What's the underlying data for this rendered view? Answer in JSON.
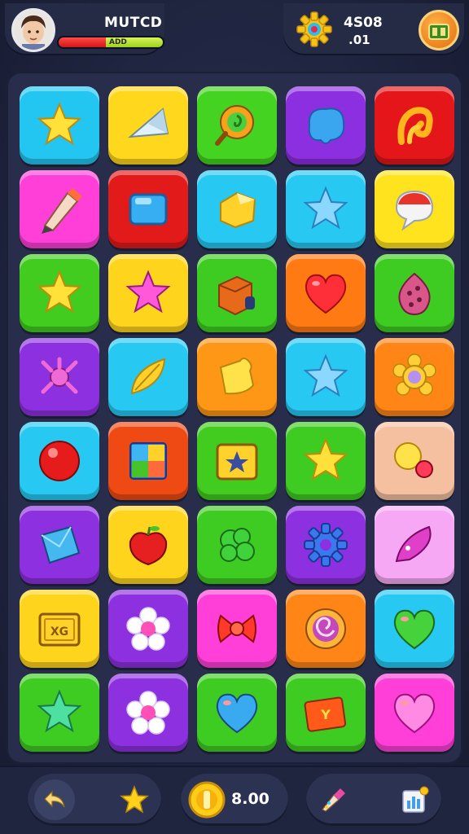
{
  "hud": {
    "player_name": "MUTCD",
    "health_label": "ADD",
    "health_level": 0.45,
    "score_top": "4S08",
    "score_bottom": ".01",
    "icons": {
      "avatar": "player-avatar",
      "gear": "gear-badge-icon",
      "chest": "treasure-chest-icon"
    },
    "colors": {
      "health_red": "#e02020",
      "health_green": "#b5e12a",
      "chest_orange": "#ef7f15"
    }
  },
  "board": {
    "rows": 8,
    "cols": 5,
    "tiles": [
      {
        "color": "#23c6f0",
        "icon": "star-icon"
      },
      {
        "color": "#ffd71c",
        "icon": "crystal-icon"
      },
      {
        "color": "#45d321",
        "icon": "swirl-ring-icon"
      },
      {
        "color": "#8b2fe0",
        "icon": "blob-icon"
      },
      {
        "color": "#e4161a",
        "icon": "tentacle-icon"
      },
      {
        "color": "#ff3fd8",
        "icon": "pencil-icon"
      },
      {
        "color": "#e21a1a",
        "icon": "square-gem-icon"
      },
      {
        "color": "#27c8f2",
        "icon": "star-cube-icon"
      },
      {
        "color": "#27c8f2",
        "icon": "star-icon"
      },
      {
        "color": "#ffe31e",
        "icon": "chat-bubble-icon"
      },
      {
        "color": "#41cc1f",
        "icon": "star-icon"
      },
      {
        "color": "#ffd41d",
        "icon": "star-icon"
      },
      {
        "color": "#3fcc22",
        "icon": "box-icon"
      },
      {
        "color": "#ff7a12",
        "icon": "heart-icon"
      },
      {
        "color": "#3fcc22",
        "icon": "egg-icon"
      },
      {
        "color": "#8d30df",
        "icon": "spider-icon"
      },
      {
        "color": "#27c8f2",
        "icon": "leaf-icon"
      },
      {
        "color": "#ff9716",
        "icon": "puzzle-icon"
      },
      {
        "color": "#27c8f2",
        "icon": "star-icon"
      },
      {
        "color": "#ff8516",
        "icon": "flower-ring-icon"
      },
      {
        "color": "#27c8f2",
        "icon": "ball-icon"
      },
      {
        "color": "#ef4a14",
        "icon": "window-icon"
      },
      {
        "color": "#41cc1f",
        "icon": "star-box-icon"
      },
      {
        "color": "#3fcc22",
        "icon": "star-icon"
      },
      {
        "color": "#f4c0a0",
        "icon": "bubbles-icon"
      },
      {
        "color": "#8d30df",
        "icon": "diamond-icon"
      },
      {
        "color": "#ffd41d",
        "icon": "apple-icon"
      },
      {
        "color": "#3fcc22",
        "icon": "bush-icon"
      },
      {
        "color": "#8d30df",
        "icon": "gear-icon"
      },
      {
        "color": "#f6a8f4",
        "icon": "feather-icon"
      },
      {
        "color": "#ffd41d",
        "icon": "crate-icon"
      },
      {
        "color": "#8d30df",
        "icon": "flower-icon"
      },
      {
        "color": "#ff3fd8",
        "icon": "bow-icon"
      },
      {
        "color": "#ff8516",
        "icon": "spiral-icon"
      },
      {
        "color": "#27c8f2",
        "icon": "heart-icon"
      },
      {
        "color": "#3fcc22",
        "icon": "star-icon"
      },
      {
        "color": "#8d30df",
        "icon": "flower-icon"
      },
      {
        "color": "#3fcc22",
        "icon": "heart-icon"
      },
      {
        "color": "#3fcc22",
        "icon": "card-icon"
      },
      {
        "color": "#ff3fd8",
        "icon": "heart-icon"
      }
    ]
  },
  "bottom_bar": {
    "coin_amount": "8.00",
    "icons": {
      "back": "undo-arrow-icon",
      "star": "star-icon",
      "coin": "coin-icon",
      "paint": "paint-brush-icon",
      "stats": "stats-chart-icon"
    }
  }
}
